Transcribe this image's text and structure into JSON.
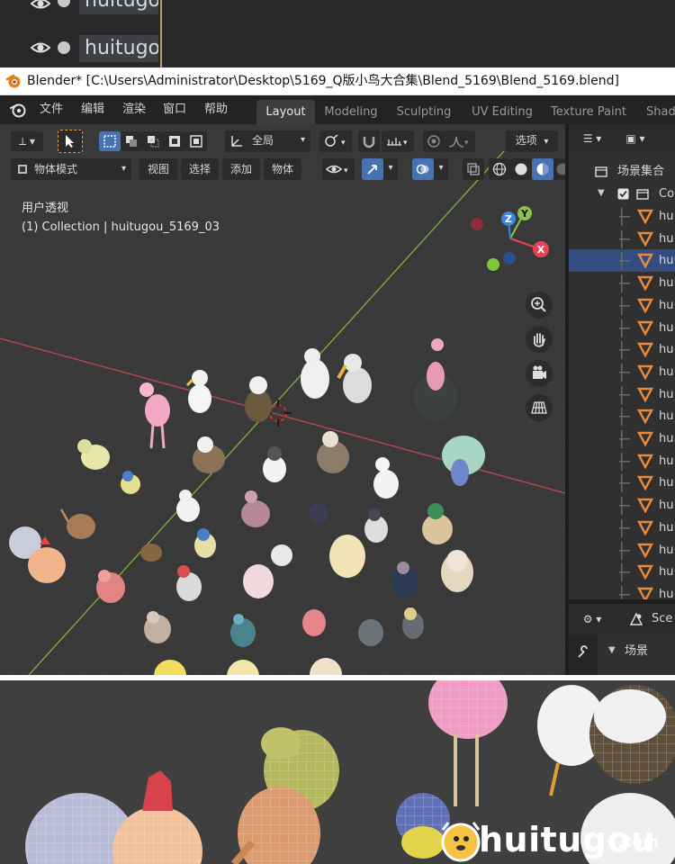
{
  "top_strip": {
    "rows": [
      {
        "label": "huitugou"
      },
      {
        "label": "huitugou"
      }
    ]
  },
  "title_bar": {
    "title": "Blender* [C:\\Users\\Administrator\\Desktop\\5169_Q版小鸟大合集\\Blend_5169\\Blend_5169.blend]"
  },
  "menu": {
    "items": [
      "文件",
      "编辑",
      "渲染",
      "窗口",
      "帮助"
    ],
    "workspace_tabs": [
      "Layout",
      "Modeling",
      "Sculpting",
      "UV Editing",
      "Texture Paint",
      "Shad"
    ],
    "active_tab": "Layout"
  },
  "viewport_header": {
    "transform_orientation": "全局",
    "options_label": "选项",
    "mode": "物体模式",
    "menus": [
      "视图",
      "选择",
      "添加",
      "物体"
    ]
  },
  "viewport": {
    "view_name": "用户透视",
    "collection_info": "(1) Collection | huitugou_5169_03",
    "gizmo": {
      "z": "Z",
      "y": "Y",
      "x": "X"
    }
  },
  "outliner": {
    "root_label": "场景集合",
    "collection_label": "Co",
    "item_label": "hu",
    "item_count": 18,
    "selected_index": 2
  },
  "properties": {
    "scene_label": "Sce",
    "section_label": "场景"
  },
  "watermark": {
    "brand": "huitugou",
    "domain": ".com"
  },
  "colors": {
    "accent_blue": "#4772b3",
    "outliner_selected": "#334d80",
    "object_orange": "#e78a3c",
    "axis_x": "#e9434f",
    "axis_y": "#8bc24a",
    "axis_z": "#3b86e3",
    "grid_bg": "#393939"
  }
}
